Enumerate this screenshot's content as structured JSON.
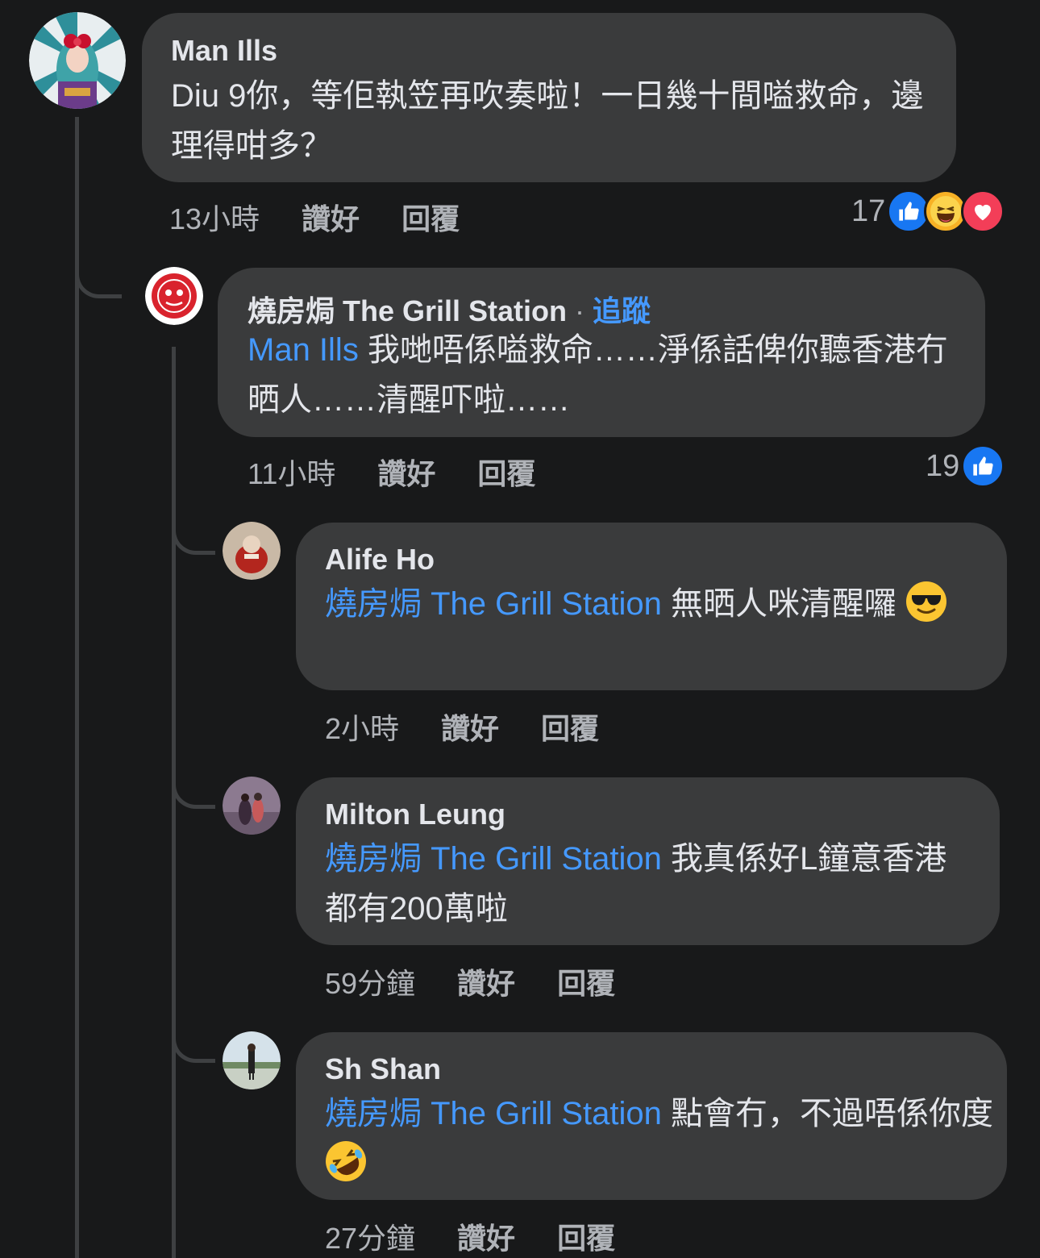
{
  "comments": [
    {
      "author": "Man Ills",
      "text": "Diu 9你，等佢執笠再吹奏啦！一日幾十間嗌救命，邊理得咁多？",
      "time": "13小時",
      "like_label": "讚好",
      "reply_label": "回覆",
      "reaction_count": "17",
      "reactions": [
        "like",
        "haha",
        "love"
      ]
    },
    {
      "author": "燒房焗 The Grill Station",
      "follow_label": "追蹤",
      "mention": "Man Ills",
      "text": "我哋唔係嗌救命……淨係話俾你聽香港冇晒人……清醒吓啦……",
      "time": "11小時",
      "like_label": "讚好",
      "reply_label": "回覆",
      "reaction_count": "19",
      "reactions": [
        "like"
      ]
    },
    {
      "author": "Alife Ho",
      "mention": "燒房焗 The Grill Station",
      "text": "無晒人咪清醒囉",
      "emoji": "smiling-face-with-sunglasses",
      "time": "2小時",
      "like_label": "讚好",
      "reply_label": "回覆"
    },
    {
      "author": "Milton Leung",
      "mention": "燒房焗 The Grill Station",
      "text": "我真係好L鐘意香港 都有200萬啦",
      "time": "59分鐘",
      "like_label": "讚好",
      "reply_label": "回覆"
    },
    {
      "author": "Sh Shan",
      "mention": "燒房焗 The Grill Station",
      "text": "點會冇，不過唔係你度",
      "emoji": "rolling-on-floor-laughing",
      "time": "27分鐘",
      "like_label": "讚好",
      "reply_label": "回覆"
    }
  ],
  "colors": {
    "background": "#18191a",
    "bubble": "#3a3b3c",
    "mention": "#4599ff",
    "secondary_text": "#b0b3b8",
    "like": "#1877f2",
    "haha": "#f7b125",
    "love": "#f33e58"
  }
}
